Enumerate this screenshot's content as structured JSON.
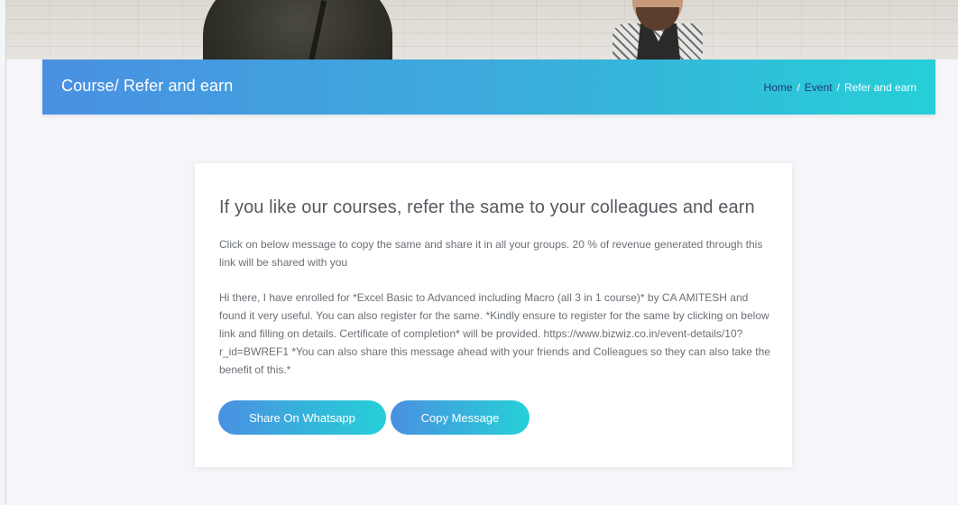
{
  "header": {
    "title": "Course/ Refer and earn",
    "breadcrumb": [
      {
        "label": "Home",
        "link": true
      },
      {
        "label": "Event",
        "link": true
      },
      {
        "label": "Refer and earn",
        "link": false
      }
    ],
    "separator": "/"
  },
  "card": {
    "heading": "If you like our courses, refer the same to your colleagues and earn",
    "intro": "Click on below message to copy the same and share it in all your groups. 20 % of revenue generated through this link will be shared with you",
    "message": "Hi there, I have enrolled for *Excel Basic to Advanced including Macro (all 3 in 1 course)* by CA AMITESH and found it very useful. You can also register for the same. *Kindly ensure to register for the same by clicking on below link and filling on details. Certificate of completion* will be provided. https://www.bizwiz.co.in/event-details/10?r_id=BWREF1 *You can also share this message ahead with your friends and Colleagues so they can also take the benefit of this.*",
    "buttons": {
      "whatsapp": "Share On Whatsapp",
      "copy": "Copy Message"
    }
  },
  "colors": {
    "gradient_start": "#4a90e2",
    "gradient_end": "#26cfd8",
    "breadcrumb_link": "#1d3b72",
    "page_background": "#f4f6f9"
  }
}
